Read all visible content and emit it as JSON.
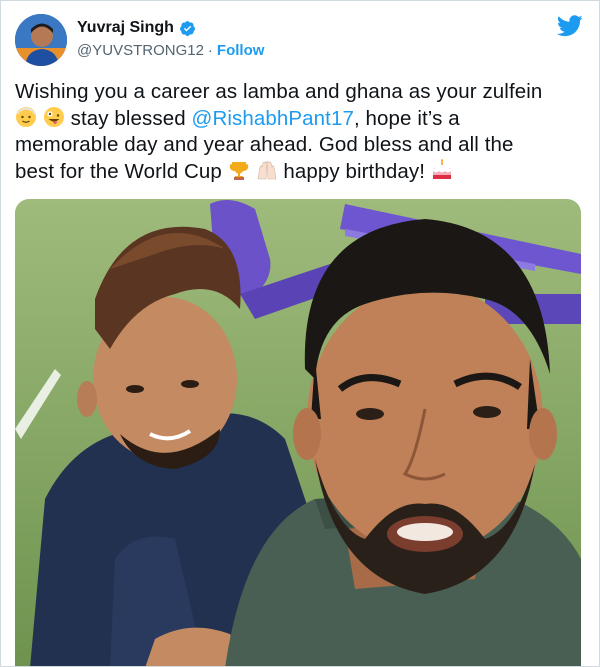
{
  "author": {
    "name": "Yuvraj Singh",
    "handle": "@YUVSTRONG12",
    "separator": "·",
    "follow_label": "Follow"
  },
  "tweet": {
    "line1": "Wishing you a career as lamba and ghana as your zulfein",
    "seg_stay": "stay blessed",
    "mention": "@RishabhPant17",
    "seg_hope": ", hope it’s a",
    "line3": "memorable day and year ahead. God bless and all the",
    "seg_best": "best for the World Cup",
    "seg_bday": "happy birthday!"
  },
  "icons": {
    "verified": "verified-badge-icon",
    "twitter": "twitter-bird-icon",
    "emojis": [
      "old-person-emoji",
      "zany-face-emoji",
      "trophy-emoji",
      "raising-hands-emoji",
      "birthday-cake-emoji"
    ]
  },
  "colors": {
    "accent": "#1d9bf0",
    "text": "#0f1419",
    "muted": "#536471"
  }
}
